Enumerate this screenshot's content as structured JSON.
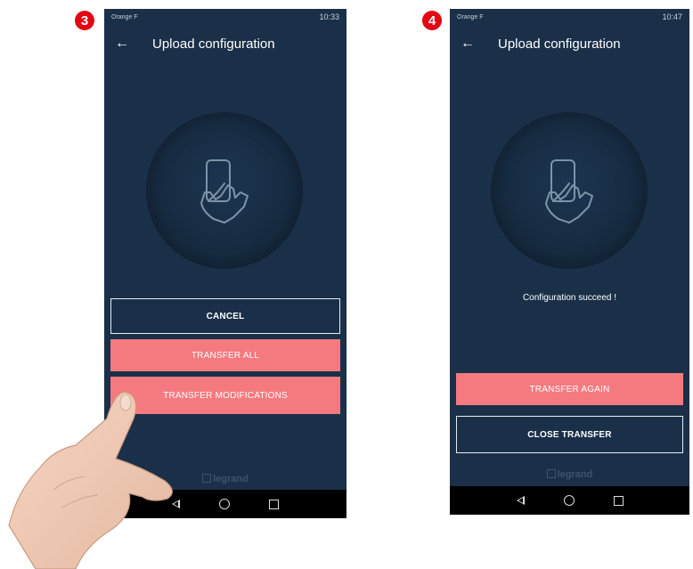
{
  "steps": [
    {
      "badge": "3",
      "status_left": "Orange F",
      "status_right": "10:33",
      "title": "Upload configuration",
      "buttons": {
        "cancel": "CANCEL",
        "transfer_all": "TRANSFER ALL",
        "transfer_modifications": "TRANSFER MODIFICATIONS"
      },
      "brand": "legrand"
    },
    {
      "badge": "4",
      "status_left": "Orange F",
      "status_right": "10:47",
      "title": "Upload configuration",
      "message": "Configuration succeed !",
      "buttons": {
        "transfer_again": "TRANSFER AGAIN",
        "close_transfer": "CLOSE TRANSFER"
      },
      "brand": "legrand"
    }
  ],
  "colors": {
    "badge": "#e30613",
    "screen_bg": "#1a3048",
    "accent_button": "#f47a7f"
  },
  "icons": [
    "back-arrow-icon",
    "phone-in-hand-icon",
    "nav-back-icon",
    "nav-home-icon",
    "nav-recent-icon",
    "pointing-hand-illustration"
  ]
}
